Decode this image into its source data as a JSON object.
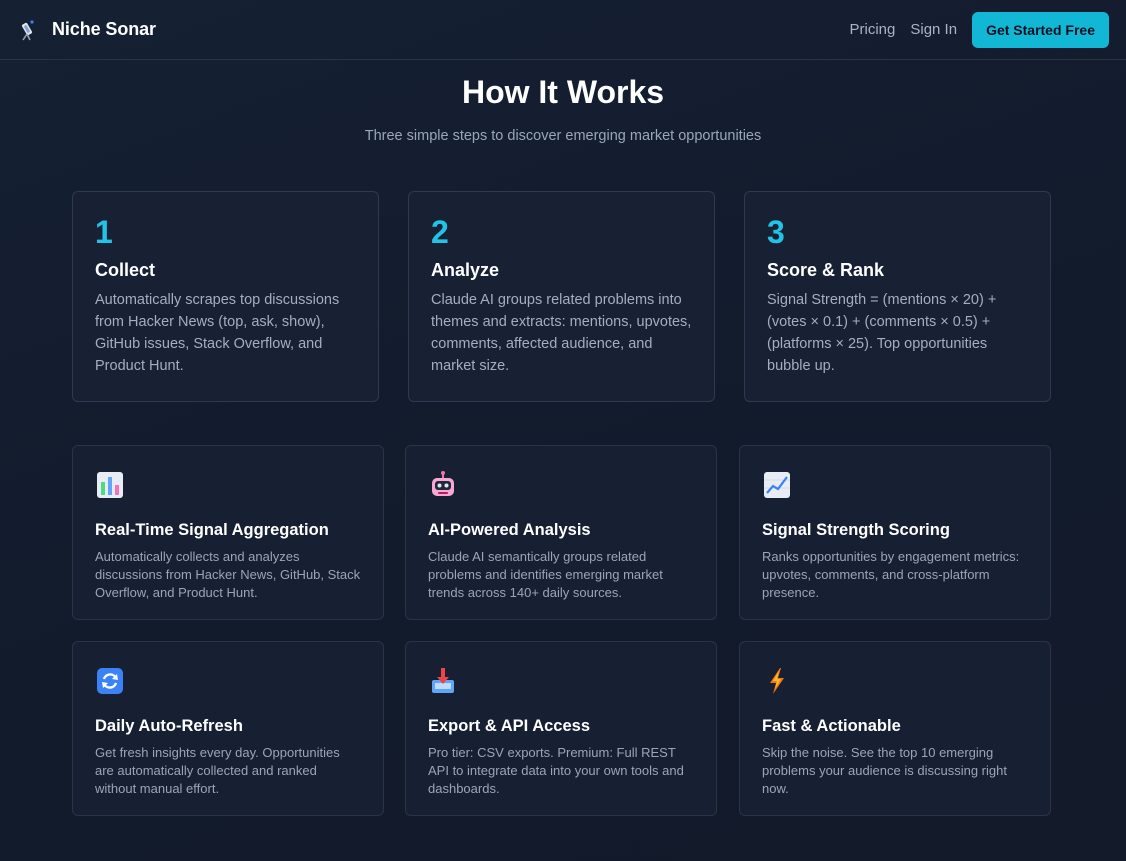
{
  "nav": {
    "brand": "Niche Sonar",
    "brand_icon": "telescope-icon",
    "links": [
      "Pricing",
      "Sign In"
    ],
    "cta_label": "Get Started Free"
  },
  "section": {
    "title": "How It Works",
    "subtitle": "Three simple steps to discover emerging market opportunities"
  },
  "steps": [
    {
      "number": "1",
      "title": "Collect",
      "desc": "Automatically scrapes top discussions from Hacker News (top, ask, show), GitHub issues, Stack Overflow, and Product Hunt."
    },
    {
      "number": "2",
      "title": "Analyze",
      "desc": "Claude AI groups related problems into themes and extracts: mentions, upvotes, comments, affected audience, and market size."
    },
    {
      "number": "3",
      "title": "Score & Rank",
      "desc": "Signal Strength = (mentions × 20) + (votes × 0.1) + (comments × 0.5) + (platforms × 25). Top opportunities bubble up."
    }
  ],
  "features": [
    {
      "icon": "bar-chart-icon",
      "title": "Real-Time Signal Aggregation",
      "desc": "Automatically collects and analyzes discussions from Hacker News, GitHub, Stack Overflow, and Product Hunt."
    },
    {
      "icon": "robot-icon",
      "title": "AI-Powered Analysis",
      "desc": "Claude AI semantically groups related problems and identifies emerging market trends across 140+ daily sources."
    },
    {
      "icon": "trending-up-icon",
      "title": "Signal Strength Scoring",
      "desc": "Ranks opportunities by engagement metrics: upvotes, comments, and cross-platform presence."
    },
    {
      "icon": "refresh-icon",
      "title": "Daily Auto-Refresh",
      "desc": "Get fresh insights every day. Opportunities are automatically collected and ranked without manual effort."
    },
    {
      "icon": "inbox-download-icon",
      "title": "Export & API Access",
      "desc": "Pro tier: CSV exports. Premium: Full REST API to integrate data into your own tools and dashboards."
    },
    {
      "icon": "lightning-icon",
      "title": "Fast & Actionable",
      "desc": "Skip the noise. See the top 10 emerging problems your audience is discussing right now."
    }
  ],
  "colors": {
    "background": "#131c2d",
    "accent": "#22c3e6",
    "cta": "#13b7d6",
    "card_border": "#2f3a4e"
  }
}
